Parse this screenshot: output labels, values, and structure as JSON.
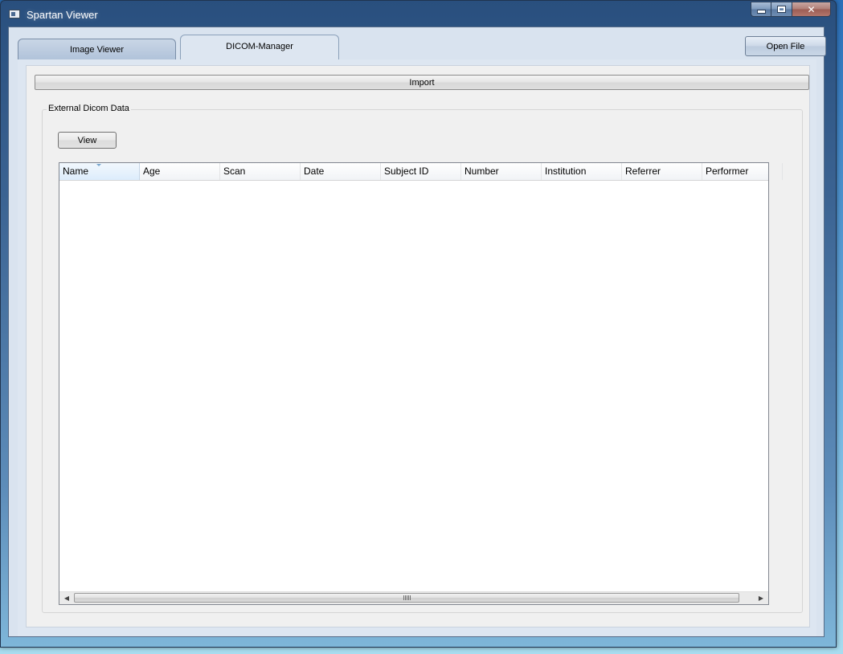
{
  "window": {
    "title": "Spartan Viewer"
  },
  "tabs": [
    {
      "label": "Image Viewer",
      "active": false
    },
    {
      "label": "DICOM-Manager",
      "active": true
    }
  ],
  "toolbar": {
    "open_file_label": "Open File"
  },
  "panel": {
    "import_label": "Import",
    "group_title": "External Dicom Data",
    "view_label": "View",
    "table": {
      "columns": [
        "Name",
        "Age",
        "Scan",
        "Date",
        "Subject ID",
        "Number",
        "Institution",
        "Referrer",
        "Performer"
      ],
      "sorted_column": "Name",
      "rows": []
    }
  },
  "colors": {
    "window_frame": "#3b6392",
    "client_bg": "#d9e3ef",
    "panel_bg": "#f0f0f0",
    "table_bg": "#ffffff",
    "close_button": "#b07f78"
  },
  "icons": {
    "app": "app-icon",
    "minimize": "minimize-icon",
    "maximize": "maximize-icon",
    "close": "close-icon",
    "sort": "sort-ascending-icon",
    "scroll_left": "scroll-left-icon",
    "scroll_right": "scroll-right-icon"
  }
}
